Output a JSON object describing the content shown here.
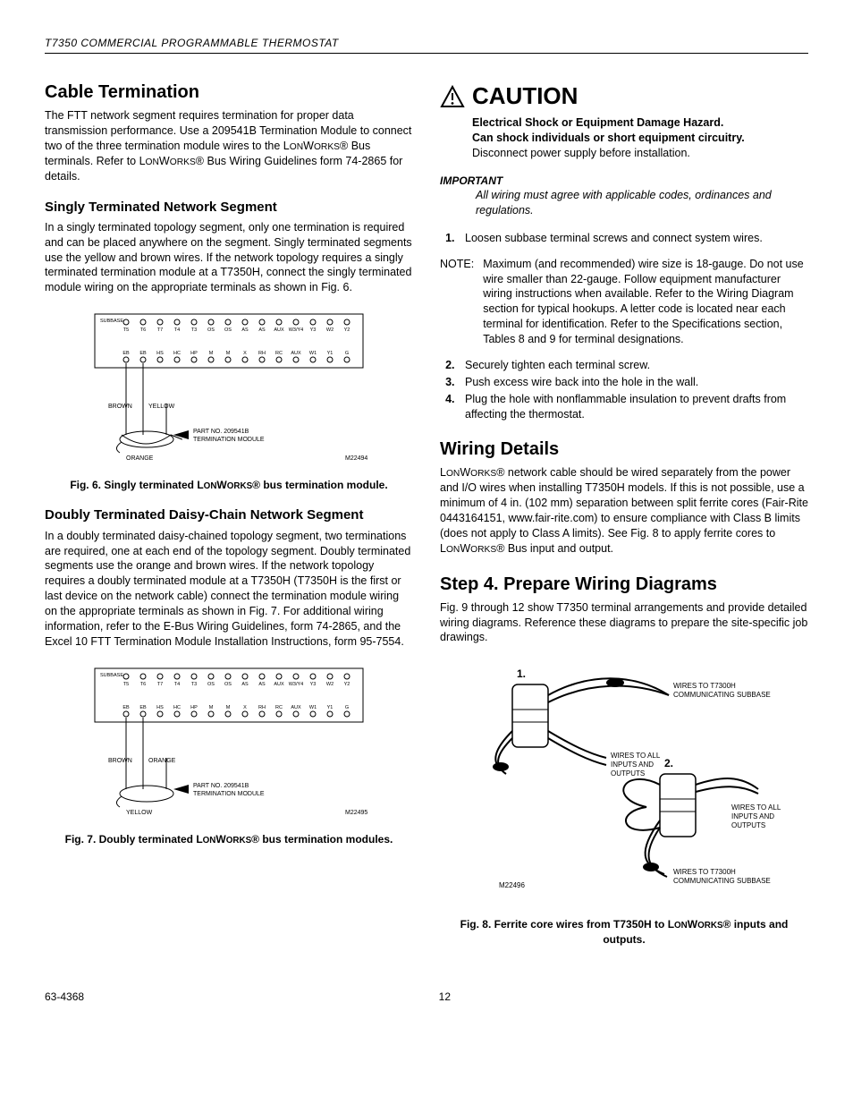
{
  "header": "T7350 COMMERCIAL PROGRAMMABLE THERMOSTAT",
  "left": {
    "h1": "Cable Termination",
    "p1_a": "The FTT network segment requires termination for proper data transmission performance. Use a 209541B Termination Module to connect two of the three termination module wires to the L",
    "p1_b": "ON",
    "p1_c": "W",
    "p1_d": "ORKS",
    "p1_e": "® Bus terminals. Refer to L",
    "p1_f": "ON",
    "p1_g": "W",
    "p1_h": "ORKS",
    "p1_i": "® Bus Wiring Guidelines form 74-2865 for details.",
    "h2a": "Singly Terminated Network Segment",
    "p2": "In a singly terminated topology segment, only one termination is required and can be placed anywhere on the segment. Singly terminated segments use the yellow and brown wires. If the network topology requires a singly terminated termination module at a T7350H, connect the singly terminated module wiring on the appropriate terminals as shown in Fig. 6.",
    "fig6_cap_a": "Fig. 6. Singly terminated L",
    "fig6_cap_b": "ON",
    "fig6_cap_c": "W",
    "fig6_cap_d": "ORKS",
    "fig6_cap_e": "® bus termination module.",
    "h2b": "Doubly Terminated Daisy-Chain Network Segment",
    "p3": "In a doubly terminated daisy-chained topology segment, two terminations are required, one at each end of the topology segment. Doubly terminated segments use the orange and brown wires. If the network topology requires a doubly terminated module at a T7350H (T7350H is the first or last device on the network cable) connect the termination module wiring on the appropriate terminals as shown in Fig. 7. For additional wiring information, refer to the E-Bus Wiring Guidelines, form 74-2865, and the Excel 10 FTT Termination Module Installation Instructions, form 95-7554.",
    "fig7_cap_a": "Fig. 7. Doubly terminated L",
    "fig7_cap_b": "ON",
    "fig7_cap_c": "W",
    "fig7_cap_d": "ORKS",
    "fig7_cap_e": "® bus termination modules.",
    "terminals_top": [
      "T5",
      "T6",
      "T7",
      "T4",
      "T3",
      "OS",
      "OS",
      "AS",
      "AS",
      "AUX",
      "W3/Y4",
      "Y3",
      "W2",
      "Y2"
    ],
    "terminals_bot": [
      "EB",
      "EB",
      "HS",
      "HC",
      "HP",
      "M",
      "M",
      "X",
      "RH",
      "RC",
      "AUX",
      "W1",
      "Y1",
      "G"
    ],
    "subbase": "SUBBASE",
    "module_line1": "PART NO. 209541B",
    "module_line2": "TERMINATION MODULE",
    "brown": "BROWN",
    "yellow": "YELLOW",
    "orange": "ORANGE",
    "fig6_id": "M22494",
    "fig7_id": "M22495"
  },
  "right": {
    "caution": "CAUTION",
    "caution_b1": "Electrical Shock or Equipment Damage Hazard.",
    "caution_b2": "Can shock individuals or short equipment circuitry.",
    "caution_p": "Disconnect power supply before installation.",
    "important": "IMPORTANT",
    "important_body": "All wiring must agree with applicable codes, ordinances and regulations.",
    "step1": "Loosen subbase terminal screws and connect system wires.",
    "note_lbl": "NOTE:",
    "note_body": "Maximum (and recommended) wire size is 18-gauge. Do not use wire smaller than 22-gauge. Follow equipment manufacturer wiring instructions when available. Refer to the Wiring Diagram section for typical hookups. A letter code is located near each terminal for identification. Refer to the Specifications section, Tables 8 and 9 for terminal designations.",
    "step2": "Securely tighten each terminal screw.",
    "step3": "Push excess wire back into the hole in the wall.",
    "step4": "Plug the hole with nonflammable insulation to prevent drafts from affecting the thermostat.",
    "h1b": "Wiring Details",
    "p4_a": "L",
    "p4_b": "ON",
    "p4_c": "W",
    "p4_d": "ORKS",
    "p4_e": "® network cable should be wired separately from the power and I/O wires when installing T7350H models. If this is not possible, use a minimum of 4 in. (102 mm) separation between split ferrite cores (Fair-Rite 0443164151, www.fair-rite.com) to ensure compliance with Class B limits (does not apply to Class A limits). See Fig. 8 to apply ferrite cores to L",
    "p4_f": "ON",
    "p4_g": "W",
    "p4_h": "ORKS",
    "p4_i": "® Bus input and output.",
    "h1c": "Step 4. Prepare Wiring Diagrams",
    "p5": "Fig. 9 through 12 show T7350 terminal arrangements and provide detailed wiring diagrams. Reference these diagrams to prepare the site-specific job drawings.",
    "fig8_step1": "1.",
    "fig8_step2": "2.",
    "fig8_l1a": "WIRES TO T7300H",
    "fig8_l1b": "COMMUNICATING SUBBASE",
    "fig8_l2a": "WIRES TO ALL",
    "fig8_l2b": "INPUTS AND",
    "fig8_l2c": "OUTPUTS",
    "fig8_id": "M22496",
    "fig8_cap_a": "Fig. 8. Ferrite core wires from T7350H to L",
    "fig8_cap_b": "ON",
    "fig8_cap_c": "W",
    "fig8_cap_d": "ORKS",
    "fig8_cap_e": "® inputs and outputs."
  },
  "footer": {
    "doc": "63-4368",
    "page": "12"
  }
}
